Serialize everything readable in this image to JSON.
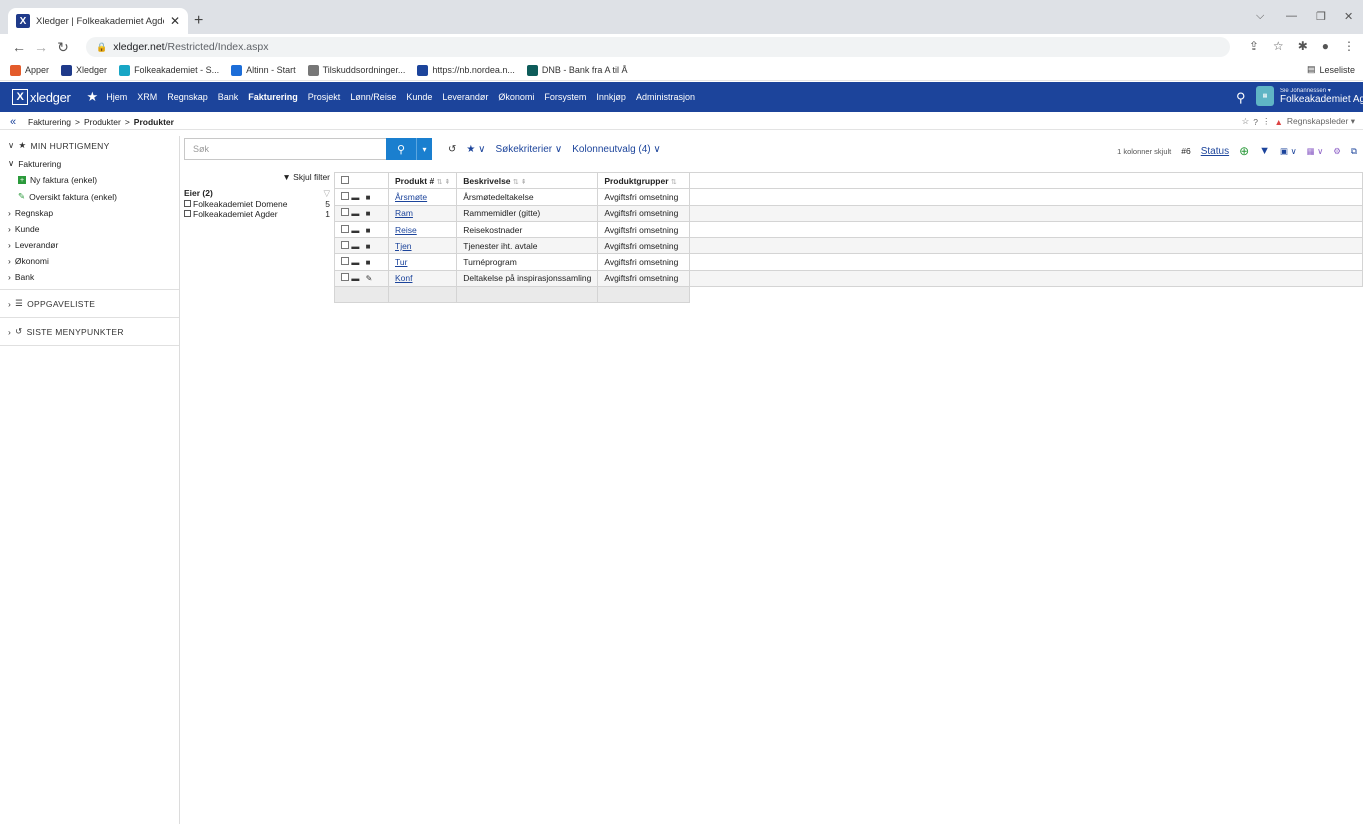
{
  "browser": {
    "tab_title": "Xledger | Folkeakademiet Agder",
    "tab_favicon": "X",
    "new_tab": "+",
    "url_host": "xledger.net",
    "url_path": "/Restricted/Index.aspx",
    "bookmarks": [
      {
        "label": "Apper",
        "color": "#e35b2b"
      },
      {
        "label": "Xledger",
        "color": "#1f3a8a"
      },
      {
        "label": "Folkeakademiet - S...",
        "color": "#18a6c5"
      },
      {
        "label": "Altinn - Start",
        "color": "#1c6dd8"
      },
      {
        "label": "Tilskuddsordninger...",
        "color": "#777777"
      },
      {
        "label": "https://nb.nordea.n...",
        "color": "#1c449b"
      },
      {
        "label": "DNB - Bank fra A til Å",
        "color": "#0e5c5a"
      }
    ],
    "reading_list": "Leseliste"
  },
  "app": {
    "logo_text": "xledger",
    "logo_box": "X",
    "menu": [
      "Hjem",
      "XRM",
      "Regnskap",
      "Bank",
      "Fakturering",
      "Prosjekt",
      "Lønn/Reise",
      "Kunde",
      "Leverandør",
      "Økonomi",
      "Forsystem",
      "Innkjøp",
      "Administrasjon"
    ],
    "active_menu_index": 4,
    "user_name": "Sie Johannessen",
    "company": "Folkeakademiet Agder",
    "brand_color": "#1c449b"
  },
  "breadcrumb": {
    "items": [
      "Fakturering",
      "Produkter"
    ],
    "current": "Produkter",
    "role": "Regnskapsleder"
  },
  "sidebar": {
    "favorites_title": "MIN HURTIGMENY",
    "fakturering": "Fakturering",
    "fakt_items": [
      "Ny faktura (enkel)",
      "Oversikt faktura (enkel)"
    ],
    "groups": [
      "Regnskap",
      "Kunde",
      "Leverandør",
      "Økonomi",
      "Bank"
    ],
    "tasks_title": "OPPGAVELISTE",
    "recent_title": "SISTE MENYPUNKTER"
  },
  "search": {
    "placeholder": "Søk",
    "criteria": "Søkekriterier",
    "columns": "Kolonneutvalg (4)",
    "hidden_cols": "1 kolonner skjult",
    "count": "#6",
    "status": "Status"
  },
  "filter": {
    "hide": "Skjul filter",
    "owner_title": "Eier (2)",
    "owners": [
      {
        "name": "Folkeakademiet Domene",
        "count": "5"
      },
      {
        "name": "Folkeakademiet Agder",
        "count": "1"
      }
    ]
  },
  "table": {
    "headers": [
      "Produkt #",
      "Beskrivelse",
      "Produktgrupper"
    ],
    "rows": [
      {
        "code": "Årsmøte",
        "desc": "Årsmøtedeltakelse",
        "group": "Avgiftsfri omsetning",
        "edit": false
      },
      {
        "code": "Ram",
        "desc": "Rammemidler (gitte)",
        "group": "Avgiftsfri omsetning",
        "edit": false
      },
      {
        "code": "Reise",
        "desc": "Reisekostnader",
        "group": "Avgiftsfri omsetning",
        "edit": false
      },
      {
        "code": "Tjen",
        "desc": "Tjenester iht. avtale",
        "group": "Avgiftsfri omsetning",
        "edit": false
      },
      {
        "code": "Tur",
        "desc": "Turnéprogram",
        "group": "Avgiftsfri omsetning",
        "edit": false
      },
      {
        "code": "Konf",
        "desc": "Deltakelse på inspirasjonssamling",
        "group": "Avgiftsfri omsetning",
        "edit": true
      }
    ]
  }
}
